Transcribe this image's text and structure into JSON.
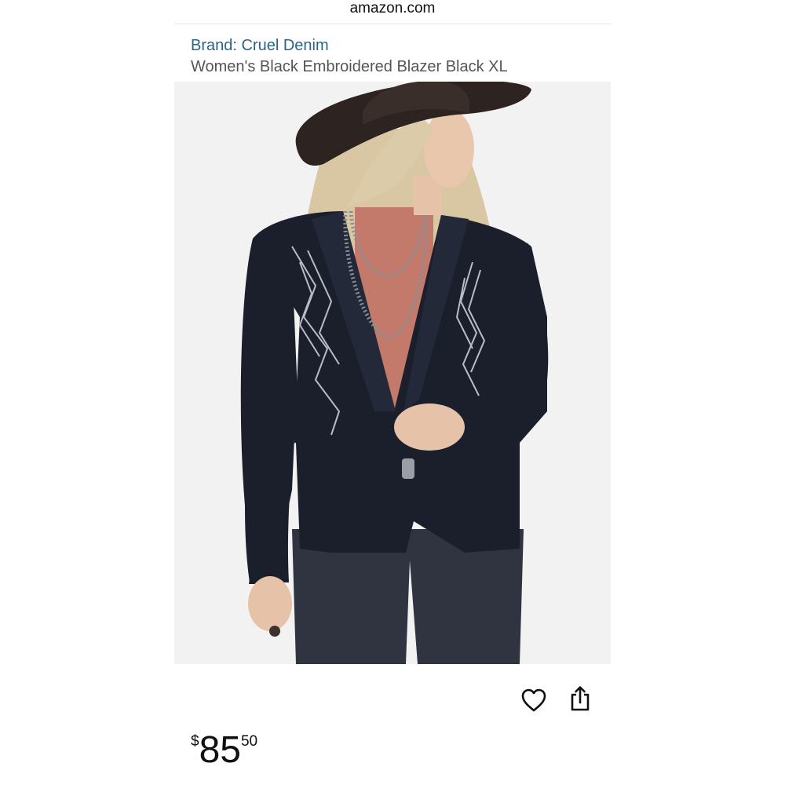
{
  "browser": {
    "url": "amazon.com"
  },
  "product": {
    "brand_label": "Brand: Cruel Denim",
    "title": "Women's Black Embroidered Blazer Black XL",
    "image_alt": "Model wearing black embroidered blazer"
  },
  "actions": {
    "wishlist_icon": "heart-icon",
    "share_icon": "share-icon"
  },
  "price": {
    "symbol": "$",
    "whole": "85",
    "fraction": "50"
  },
  "colors": {
    "brand_link": "#2b6583",
    "title": "#555555",
    "price": "#0f1111"
  }
}
